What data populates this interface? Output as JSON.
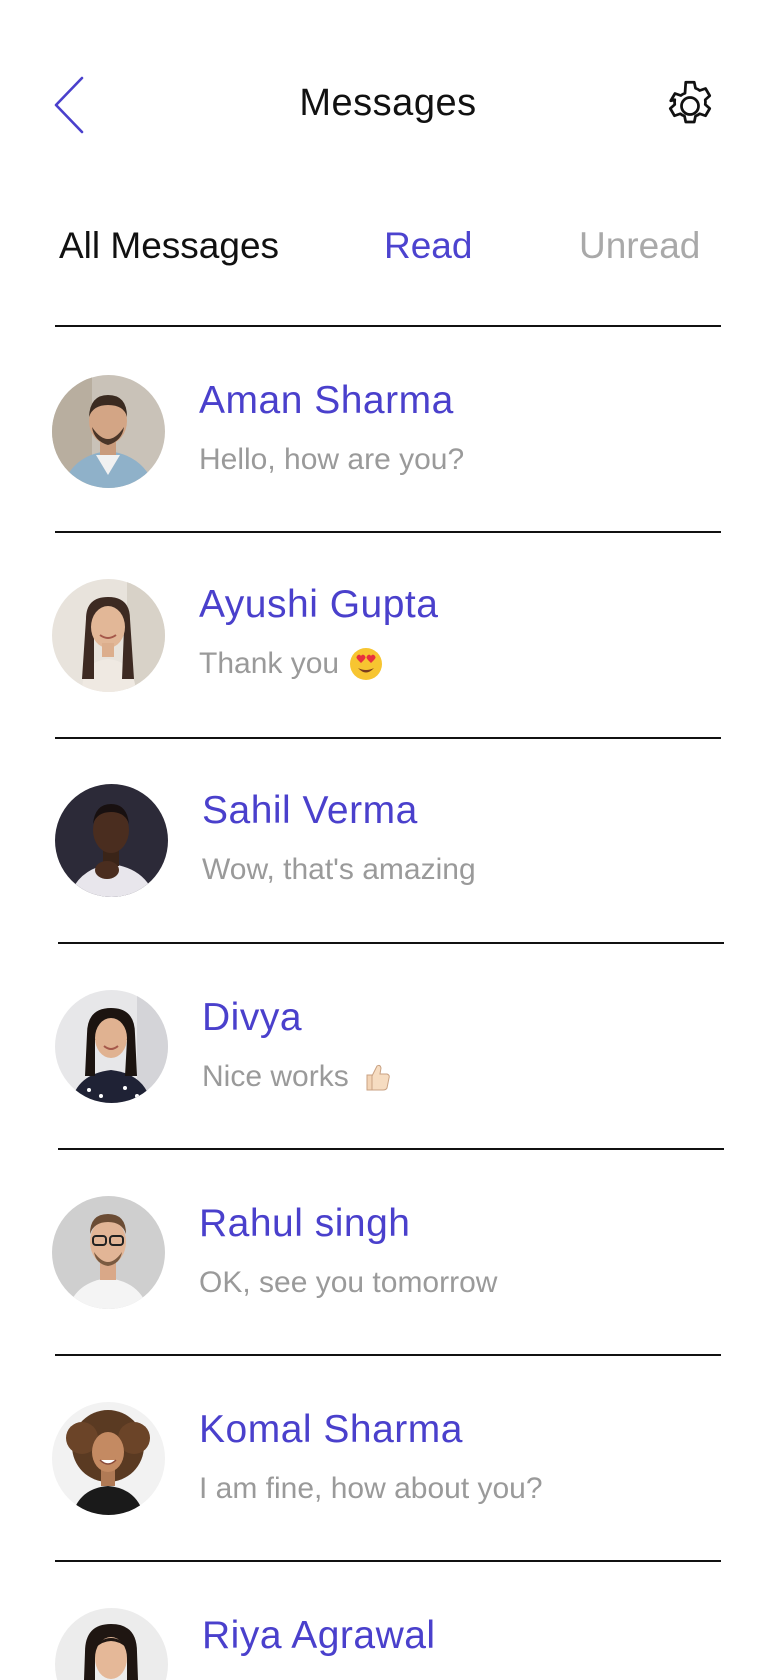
{
  "header": {
    "title": "Messages",
    "back_icon": "chevron-left-icon",
    "settings_icon": "gear-icon",
    "accent_color": "#4a40cc"
  },
  "tabs": [
    {
      "label": "All Messages",
      "state": "active"
    },
    {
      "label": "Read",
      "state": "accent"
    },
    {
      "label": "Unread",
      "state": "inactive"
    }
  ],
  "conversations": [
    {
      "name": "Aman Sharma",
      "message": "Hello, how are you?",
      "emoji": ""
    },
    {
      "name": "Ayushi Gupta",
      "message": "Thank you",
      "emoji": "heart-eyes-emoji"
    },
    {
      "name": "Sahil Verma",
      "message": "Wow, that's amazing",
      "emoji": ""
    },
    {
      "name": "Divya",
      "message": "Nice works",
      "emoji": "thumbs-up-emoji"
    },
    {
      "name": "Rahul singh",
      "message": "OK, see you tomorrow",
      "emoji": ""
    },
    {
      "name": "Komal Sharma",
      "message": "I am fine, how about you?",
      "emoji": ""
    },
    {
      "name": "Riya Agrawal",
      "message": "",
      "emoji": ""
    }
  ]
}
